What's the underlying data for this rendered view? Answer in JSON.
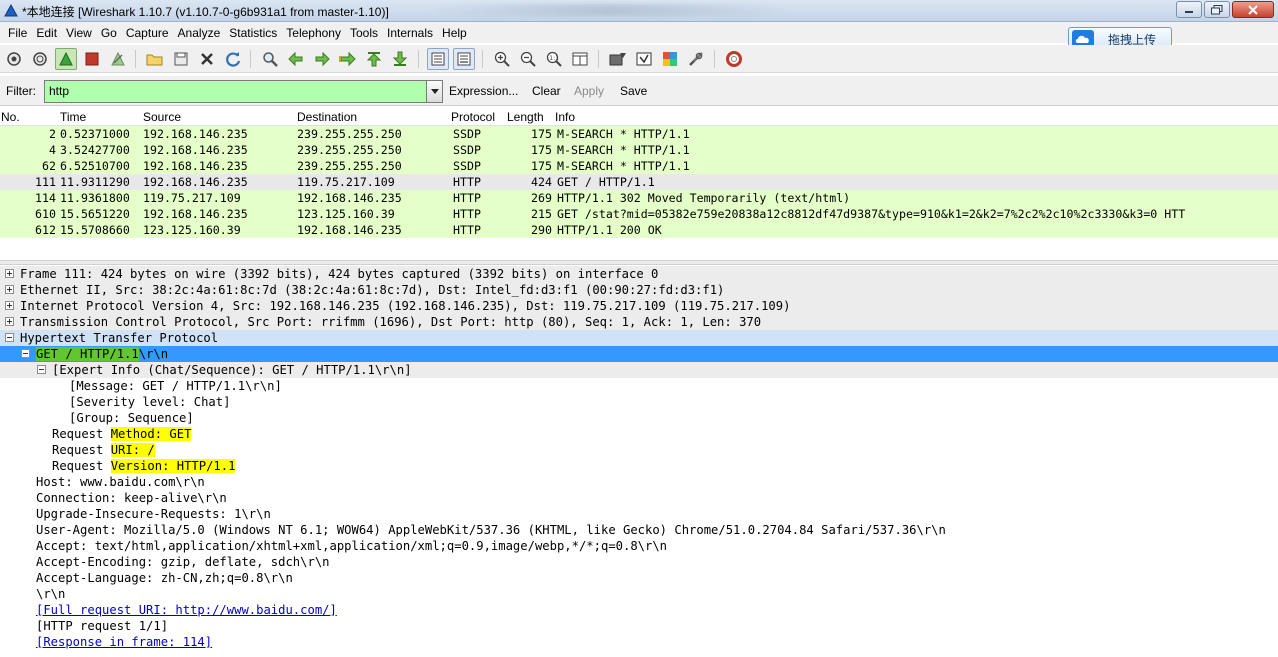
{
  "window": {
    "title": "*本地连接   [Wireshark 1.10.7  (v1.10.7-0-g6b931a1 from master-1.10)]"
  },
  "menu": [
    "File",
    "Edit",
    "View",
    "Go",
    "Capture",
    "Analyze",
    "Statistics",
    "Telephony",
    "Tools",
    "Internals",
    "Help"
  ],
  "upload_button": {
    "label": "拖拽上传",
    "icon": "cloud-icon"
  },
  "toolbar": {
    "icons": [
      "interface-list-icon",
      "capture-options-icon",
      "start-capture-icon",
      "stop-capture-icon",
      "restart-capture-icon",
      "open-file-icon",
      "save-file-icon",
      "close-file-icon",
      "reload-icon",
      "find-packet-icon",
      "go-back-icon",
      "go-forward-icon",
      "go-to-packet-icon",
      "go-first-icon",
      "go-last-icon",
      "autoscroll-icon",
      "colorize-icon",
      "zoom-in-icon",
      "zoom-out-icon",
      "normal-size-icon",
      "resize-columns-icon",
      "capture-filters-icon",
      "display-filters-icon",
      "coloring-rules-icon",
      "preferences-icon",
      "help-icon"
    ]
  },
  "filter": {
    "label": "Filter:",
    "value": "http",
    "expression": "Expression...",
    "clear": "Clear",
    "apply": "Apply",
    "save": "Save",
    "colors": {
      "valid": "#afffaf"
    }
  },
  "packet_list": {
    "columns": [
      "No.",
      "Time",
      "Source",
      "Destination",
      "Protocol",
      "Length",
      "Info"
    ],
    "rows": [
      {
        "no": "2",
        "time": "0.52371000",
        "src": "192.168.146.235",
        "dst": "239.255.255.250",
        "proto": "SSDP",
        "len": "175",
        "info": "M-SEARCH * HTTP/1.1",
        "color": "#e4ffc7"
      },
      {
        "no": "4",
        "time": "3.52427700",
        "src": "192.168.146.235",
        "dst": "239.255.255.250",
        "proto": "SSDP",
        "len": "175",
        "info": "M-SEARCH * HTTP/1.1",
        "color": "#e4ffc7"
      },
      {
        "no": "62",
        "time": "6.52510700",
        "src": "192.168.146.235",
        "dst": "239.255.255.250",
        "proto": "SSDP",
        "len": "175",
        "info": "M-SEARCH * HTTP/1.1",
        "color": "#e4ffc7"
      },
      {
        "no": "111",
        "time": "11.9311290",
        "src": "192.168.146.235",
        "dst": "119.75.217.109",
        "proto": "HTTP",
        "len": "424",
        "info": "GET / HTTP/1.1",
        "color": "#e8e8e8"
      },
      {
        "no": "114",
        "time": "11.9361800",
        "src": "119.75.217.109",
        "dst": "192.168.146.235",
        "proto": "HTTP",
        "len": "269",
        "info": "HTTP/1.1 302 Moved Temporarily  (text/html)",
        "color": "#e4ffc7"
      },
      {
        "no": "610",
        "time": "15.5651220",
        "src": "192.168.146.235",
        "dst": "123.125.160.39",
        "proto": "HTTP",
        "len": "215",
        "info": "GET /stat?mid=05382e759e20838a12c8812df47d9387&type=910&k1=2&k2=7%2c2%2c10%2c3330&k3=0 HTT",
        "color": "#e4ffc7"
      },
      {
        "no": "612",
        "time": "15.5708660",
        "src": "123.125.160.39",
        "dst": "192.168.146.235",
        "proto": "HTTP",
        "len": "290",
        "info": "HTTP/1.1 200 OK",
        "color": "#e4ffc7"
      }
    ]
  },
  "details": {
    "frame": "Frame 111: 424 bytes on wire (3392 bits), 424 bytes captured (3392 bits) on interface 0",
    "ethernet": "Ethernet II, Src: 38:2c:4a:61:8c:7d (38:2c:4a:61:8c:7d), Dst: Intel_fd:d3:f1 (00:90:27:fd:d3:f1)",
    "ip": "Internet Protocol Version 4, Src: 192.168.146.235 (192.168.146.235), Dst: 119.75.217.109 (119.75.217.109)",
    "tcp": "Transmission Control Protocol, Src Port: rrifmm (1696), Dst Port: http (80), Seq: 1, Ack: 1, Len: 370",
    "http": "Hypertext Transfer Protocol",
    "req_line": {
      "method": "GET",
      "sep": " / ",
      "version": "HTTP/1.1",
      "tail": "\\r\\n"
    },
    "expert": "[Expert Info (Chat/Sequence): GET / HTTP/1.1\\r\\n]",
    "expert_message": "[Message: GET / HTTP/1.1\\r\\n]",
    "expert_severity": "[Severity level: Chat]",
    "expert_group": "[Group: Sequence]",
    "req_prefix": "Request ",
    "req_method": "Method: GET",
    "req_uri": "URI: /",
    "req_version": "Version: HTTP/1.1",
    "host": "Host: www.baidu.com\\r\\n",
    "connection": "Connection: keep-alive\\r\\n",
    "upgrade": "Upgrade-Insecure-Requests: 1\\r\\n",
    "user_agent": "User-Agent: Mozilla/5.0 (Windows NT 6.1; WOW64) AppleWebKit/537.36 (KHTML, like Gecko) Chrome/51.0.2704.84 Safari/537.36\\r\\n",
    "accept": "Accept: text/html,application/xhtml+xml,application/xml;q=0.9,image/webp,*/*;q=0.8\\r\\n",
    "accept_encoding": "Accept-Encoding: gzip, deflate, sdch\\r\\n",
    "accept_language": "Accept-Language: zh-CN,zh;q=0.8\\r\\n",
    "crlf": "\\r\\n",
    "full_uri": "[Full request URI: http://www.baidu.com/]",
    "request_count": "[HTTP request 1/1]",
    "response_in": "[Response in frame: 114]"
  }
}
